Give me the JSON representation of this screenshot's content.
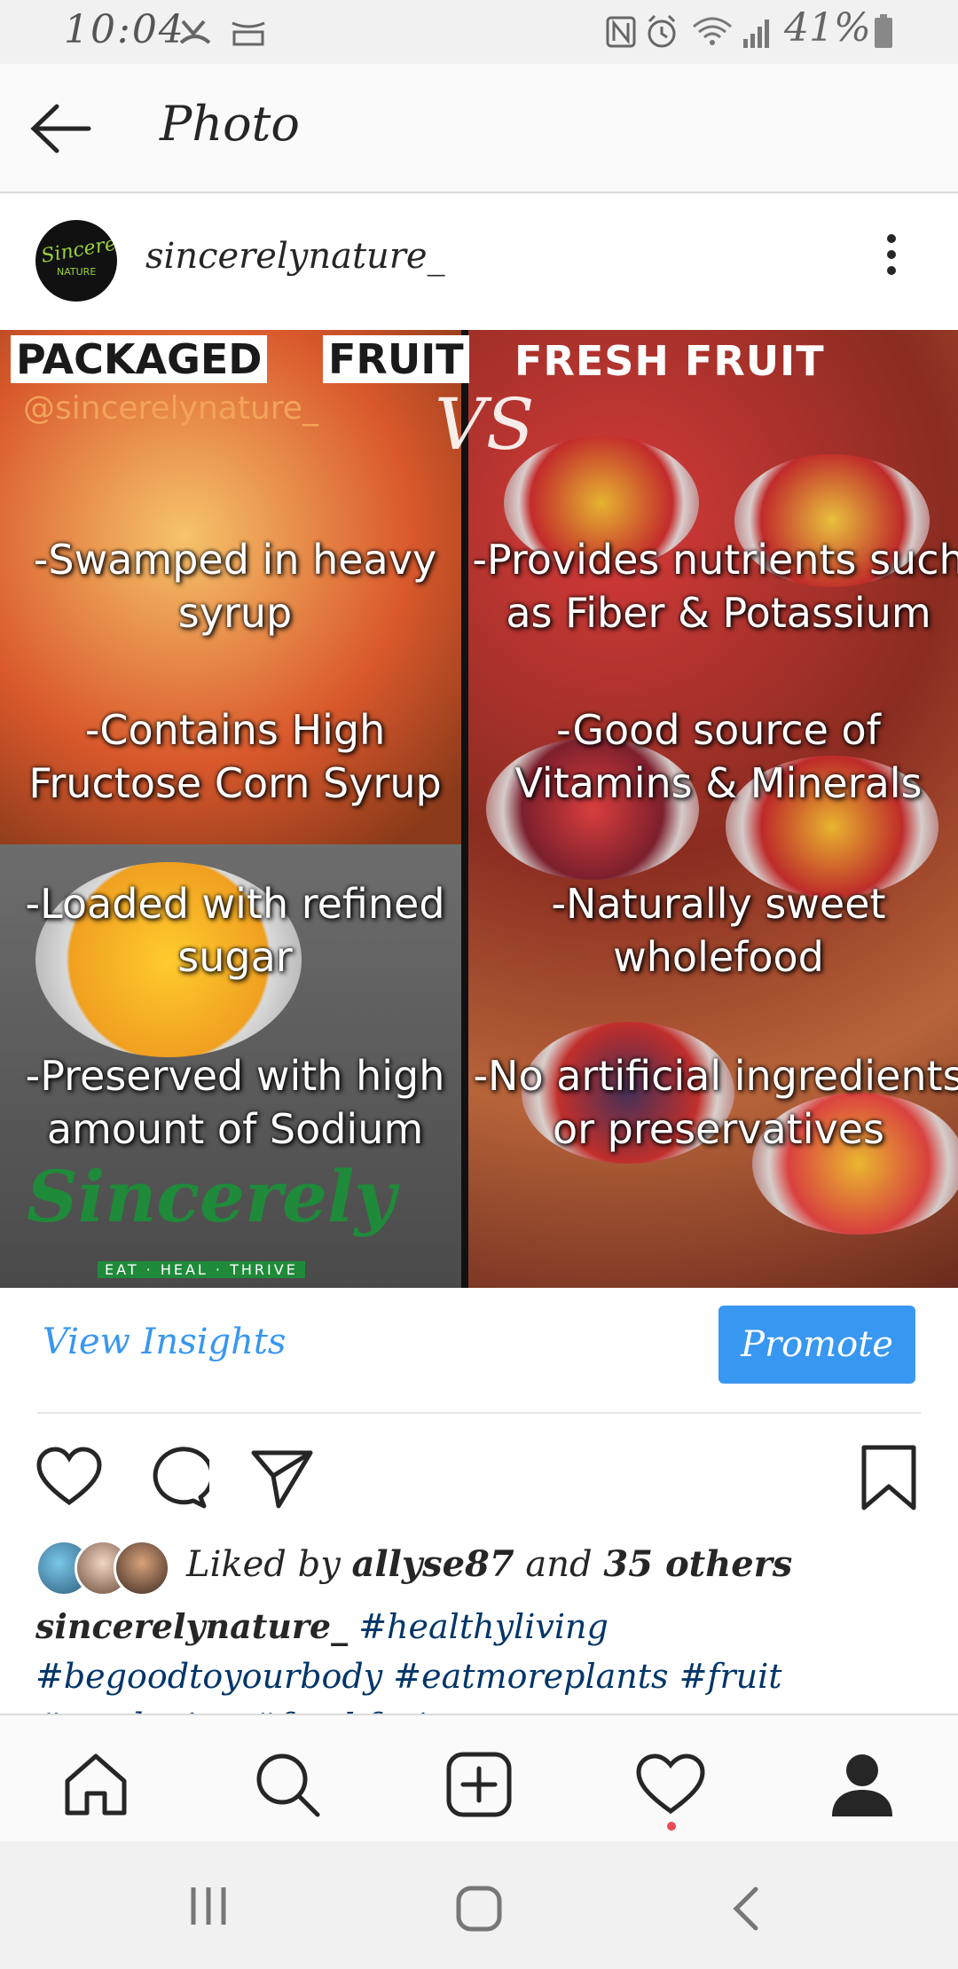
{
  "status_bar": {
    "time": "10:04",
    "battery": "41%"
  },
  "top_bar": {
    "title": "Photo"
  },
  "post": {
    "username": "sincerelynature_",
    "avatar_text": "Sincerely",
    "avatar_subtext": "NATURE",
    "image": {
      "left_header_1": "PACKAGED",
      "left_header_2": "FRUIT",
      "right_header": "FRESH FRUIT",
      "handle": "@sincerelynature_",
      "vs": "VS",
      "left_facts": [
        "-Swamped in heavy syrup",
        "-Contains High Fructose Corn Syrup",
        "-Loaded with refined sugar",
        "-Preserved with high amount of Sodium"
      ],
      "right_facts": [
        "-Provides nutrients such as Fiber & Potassium",
        "-Good source of Vitamins & Minerals",
        "-Naturally sweet wholefood",
        "-No artificial ingredients or preservatives"
      ],
      "logo_text": "Sincerely",
      "logo_tagline": "EAT · HEAL · THRIVE"
    },
    "view_insights": "View Insights",
    "promote": "Promote",
    "liked_prefix": "Liked by",
    "liked_user": "allyse87",
    "liked_and": "and",
    "liked_others": "35 others",
    "caption_user": "sincerelynature_",
    "hashtags": [
      "#healthyliving",
      "#begoodtoyourbody",
      "#eatmoreplants",
      "#fruit",
      "#gardening",
      "#freshfruit"
    ]
  },
  "colors": {
    "accent": "#3897f0",
    "hashtag": "#003569",
    "notification_dot": "#ed4956"
  }
}
